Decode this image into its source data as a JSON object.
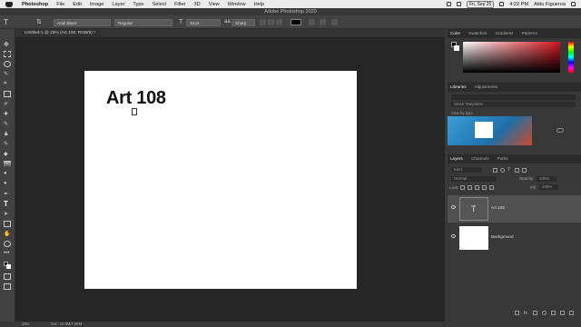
{
  "menubar": {
    "app": "Photoshop",
    "items": [
      "File",
      "Edit",
      "Image",
      "Layer",
      "Type",
      "Select",
      "Filter",
      "3D",
      "View",
      "Window",
      "Help"
    ],
    "date": "Fri, Sep 25",
    "time": "4:22 PM",
    "user": "Aldo Figueroa"
  },
  "window": {
    "title": "Adobe Photoshop 2020"
  },
  "options": {
    "font_family": "Arial Black",
    "font_style": "Regular",
    "font_size": "48 pt",
    "antialias": "Sharp"
  },
  "document": {
    "tab": "Untitled-1 @ 25% (Art 108, RGB/8) *",
    "text_layer_content": "Art 108"
  },
  "panels": {
    "color_tabs": [
      "Color",
      "Swatches",
      "Gradients",
      "Patterns"
    ],
    "library_tabs": [
      "Libraries",
      "Adjustments"
    ],
    "library_search": "Stock Templates",
    "library_view": "View by type",
    "layers_tabs": [
      "Layers",
      "Channels",
      "Paths"
    ],
    "kind": "Kind",
    "blend_mode": "Normal",
    "opacity_label": "Opacity:",
    "opacity": "100%",
    "lock_label": "Lock:",
    "fill_label": "Fill:",
    "fill": "100%",
    "layers": [
      {
        "name": "Art 108",
        "type": "text"
      },
      {
        "name": "Background",
        "type": "image"
      }
    ]
  },
  "status": {
    "zoom": "25%",
    "doc": "Doc: 10.9M/7.89M"
  },
  "colors": {
    "accent": "#d3131e",
    "canvas": "#ffffff",
    "ui_bg": "#262626"
  }
}
